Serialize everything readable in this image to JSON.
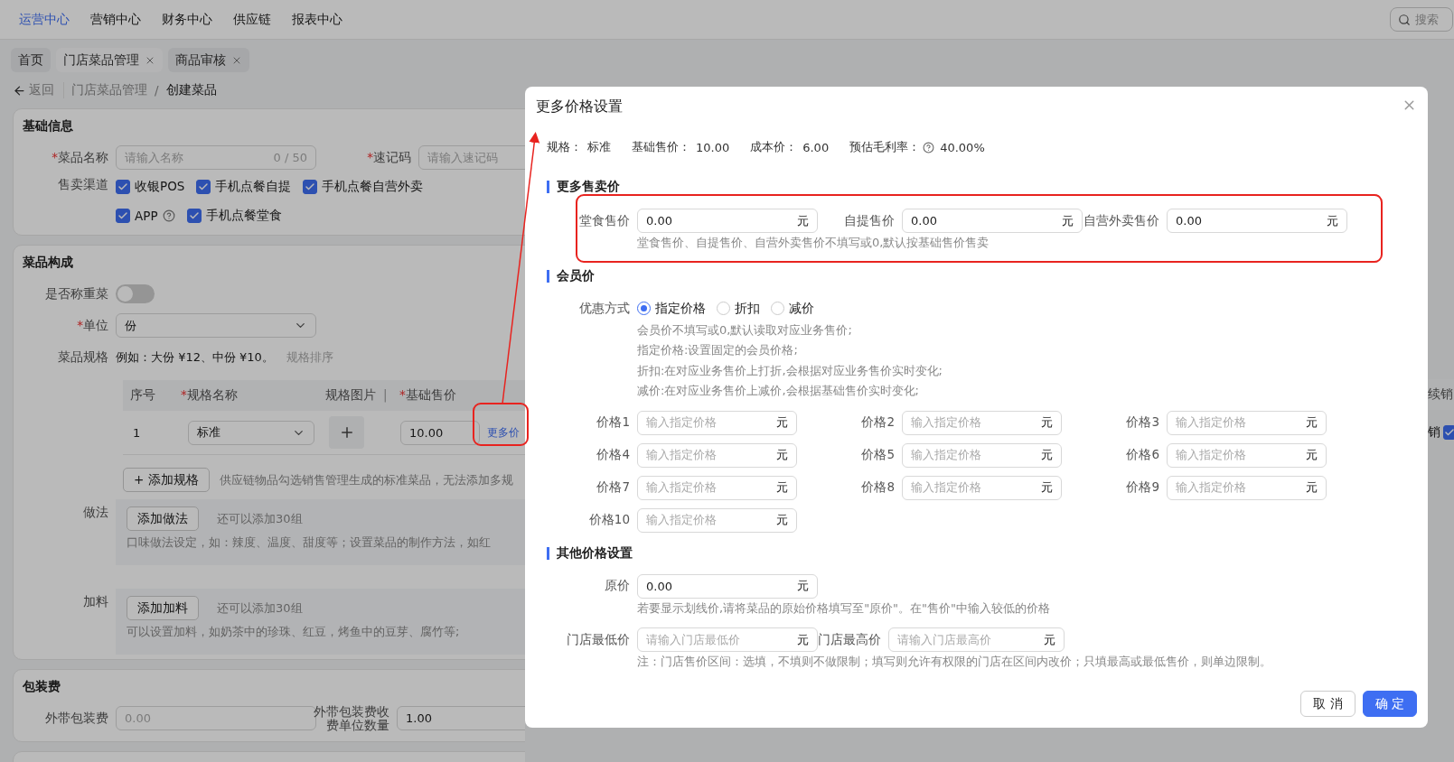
{
  "top_nav": {
    "items": [
      {
        "label": "运营中心",
        "selected": true
      },
      {
        "label": "营销中心",
        "selected": false
      },
      {
        "label": "财务中心",
        "selected": false
      },
      {
        "label": "供应链",
        "selected": false
      },
      {
        "label": "报表中心",
        "selected": false
      }
    ],
    "search": {
      "placeholder": "搜索"
    }
  },
  "page_tabs": [
    {
      "label": "首页",
      "selected": false,
      "closable": false
    },
    {
      "label": "门店菜品管理",
      "selected": true,
      "closable": true
    },
    {
      "label": "商品审核",
      "selected": false,
      "closable": true
    }
  ],
  "breadcrumb": {
    "back": "返回",
    "items": [
      "门店菜品管理",
      "创建菜品"
    ],
    "separator": "/"
  },
  "basic_info": {
    "title": "基础信息",
    "name_field": {
      "label": "菜品名称",
      "required_mark": "*",
      "placeholder": "请输入名称",
      "counter": "0 / 50"
    },
    "code_field": {
      "label": "速记码",
      "required_mark": "*",
      "placeholder": "请输入速记码"
    },
    "channels_label": "售卖渠道",
    "channels": [
      {
        "label": "收银POS",
        "checked": true,
        "help": false
      },
      {
        "label": "手机点餐自提",
        "checked": true,
        "help": false
      },
      {
        "label": "手机点餐自营外卖",
        "checked": true,
        "help": false
      },
      {
        "label": "APP",
        "checked": true,
        "help": true
      },
      {
        "label": "手机点餐堂食",
        "checked": true,
        "help": false
      }
    ]
  },
  "composition": {
    "title": "菜品构成",
    "weigh": {
      "label": "是否称重菜",
      "on": false
    },
    "unit": {
      "label": "单位",
      "required_mark": "*",
      "value": "份"
    },
    "spec": {
      "label": "菜品规格",
      "example": "例如：大份 ¥12、中份 ¥10。",
      "sort_link": "规格排序"
    },
    "spec_table": {
      "columns": [
        {
          "label": "序号"
        },
        {
          "label": "规格名称",
          "required_mark": "*"
        },
        {
          "label": "规格图片",
          "divider": "|"
        },
        {
          "label": "基础售价",
          "required_mark": "*"
        }
      ],
      "rows": [
        {
          "index": "1",
          "name": "标准",
          "base_price": "10.00",
          "more_link": "更多价"
        }
      ]
    },
    "add_spec": {
      "label": "+ 添加规格",
      "note": "供应链物品勾选销售管理生成的标准菜品，无法添加多规"
    },
    "groups": [
      {
        "label": "做法",
        "button": "添加做法",
        "remaining": "还可以添加30组",
        "note": "口味做法设定，如：辣度、温度、甜度等；设置菜品的制作方法，如红"
      },
      {
        "label": "加料",
        "button": "添加加料",
        "remaining": "还可以添加30组",
        "note": "可以设置加料，如奶茶中的珍珠、红豆，烤鱼中的豆芽、腐竹等;"
      }
    ]
  },
  "packaging": {
    "title": "包装费",
    "fee": {
      "label": "外带包装费",
      "placeholder": "0.00"
    },
    "unit_qty": {
      "label": "外带包装费收费单位数量",
      "value": "1.00"
    }
  },
  "right_strip": {
    "column_header": "续销",
    "row_text": "销",
    "row_checked": true
  },
  "modal": {
    "title": "更多价格设置",
    "summary": [
      {
        "label": "规格：",
        "value": "标准",
        "help": false
      },
      {
        "label": "基础售价：",
        "value": "10.00",
        "help": false
      },
      {
        "label": "成本价：",
        "value": "6.00",
        "help": false
      },
      {
        "label": "预估毛利率：",
        "value": "40.00%",
        "help": true
      }
    ],
    "sale_prices": {
      "title": "更多售卖价",
      "fields": [
        {
          "label": "堂食售价",
          "value": "0.00",
          "unit": "元"
        },
        {
          "label": "自提售价",
          "value": "0.00",
          "unit": "元"
        },
        {
          "label": "自营外卖售价",
          "value": "0.00",
          "unit": "元"
        }
      ],
      "hint": "堂食售价、自提售价、自营外卖售价不填写或0,默认按基础售价售卖"
    },
    "member_price": {
      "title": "会员价",
      "mode_label": "优惠方式",
      "modes": [
        {
          "label": "指定价格",
          "selected": true
        },
        {
          "label": "折扣",
          "selected": false
        },
        {
          "label": "减价",
          "selected": false
        }
      ],
      "notes": [
        "会员价不填写或0,默认读取对应业务售价;",
        "指定价格:设置固定的会员价格;",
        "折扣:在对应业务售价上打折,会根据对应业务售价实时变化;",
        "减价:在对应业务售价上减价,会根据基础售价实时变化;"
      ],
      "prices": [
        {
          "label": "价格1",
          "placeholder": "输入指定价格",
          "unit": "元"
        },
        {
          "label": "价格2",
          "placeholder": "输入指定价格",
          "unit": "元"
        },
        {
          "label": "价格3",
          "placeholder": "输入指定价格",
          "unit": "元"
        },
        {
          "label": "价格4",
          "placeholder": "输入指定价格",
          "unit": "元"
        },
        {
          "label": "价格5",
          "placeholder": "输入指定价格",
          "unit": "元"
        },
        {
          "label": "价格6",
          "placeholder": "输入指定价格",
          "unit": "元"
        },
        {
          "label": "价格7",
          "placeholder": "输入指定价格",
          "unit": "元"
        },
        {
          "label": "价格8",
          "placeholder": "输入指定价格",
          "unit": "元"
        },
        {
          "label": "价格9",
          "placeholder": "输入指定价格",
          "unit": "元"
        },
        {
          "label": "价格10",
          "placeholder": "输入指定价格",
          "unit": "元"
        }
      ]
    },
    "other_prices": {
      "title": "其他价格设置",
      "original": {
        "label": "原价",
        "value": "0.00",
        "unit": "元"
      },
      "original_hint": "若要显示划线价,请将菜品的原始价格填写至\"原价\"。在\"售价\"中输入较低的价格",
      "range": [
        {
          "label": "门店最低价",
          "placeholder": "请输入门店最低价",
          "unit": "元"
        },
        {
          "label": "门店最高价",
          "placeholder": "请输入门店最高价",
          "unit": "元"
        }
      ],
      "range_note": "注：门店售价区间：选填，不填则不做限制；填写则允许有权限的门店在区间内改价；只填最高或最低售价，则单边限制。"
    },
    "buttons": [
      {
        "label": "取 消",
        "kind": "secondary"
      },
      {
        "label": "确 定",
        "kind": "primary"
      }
    ]
  }
}
